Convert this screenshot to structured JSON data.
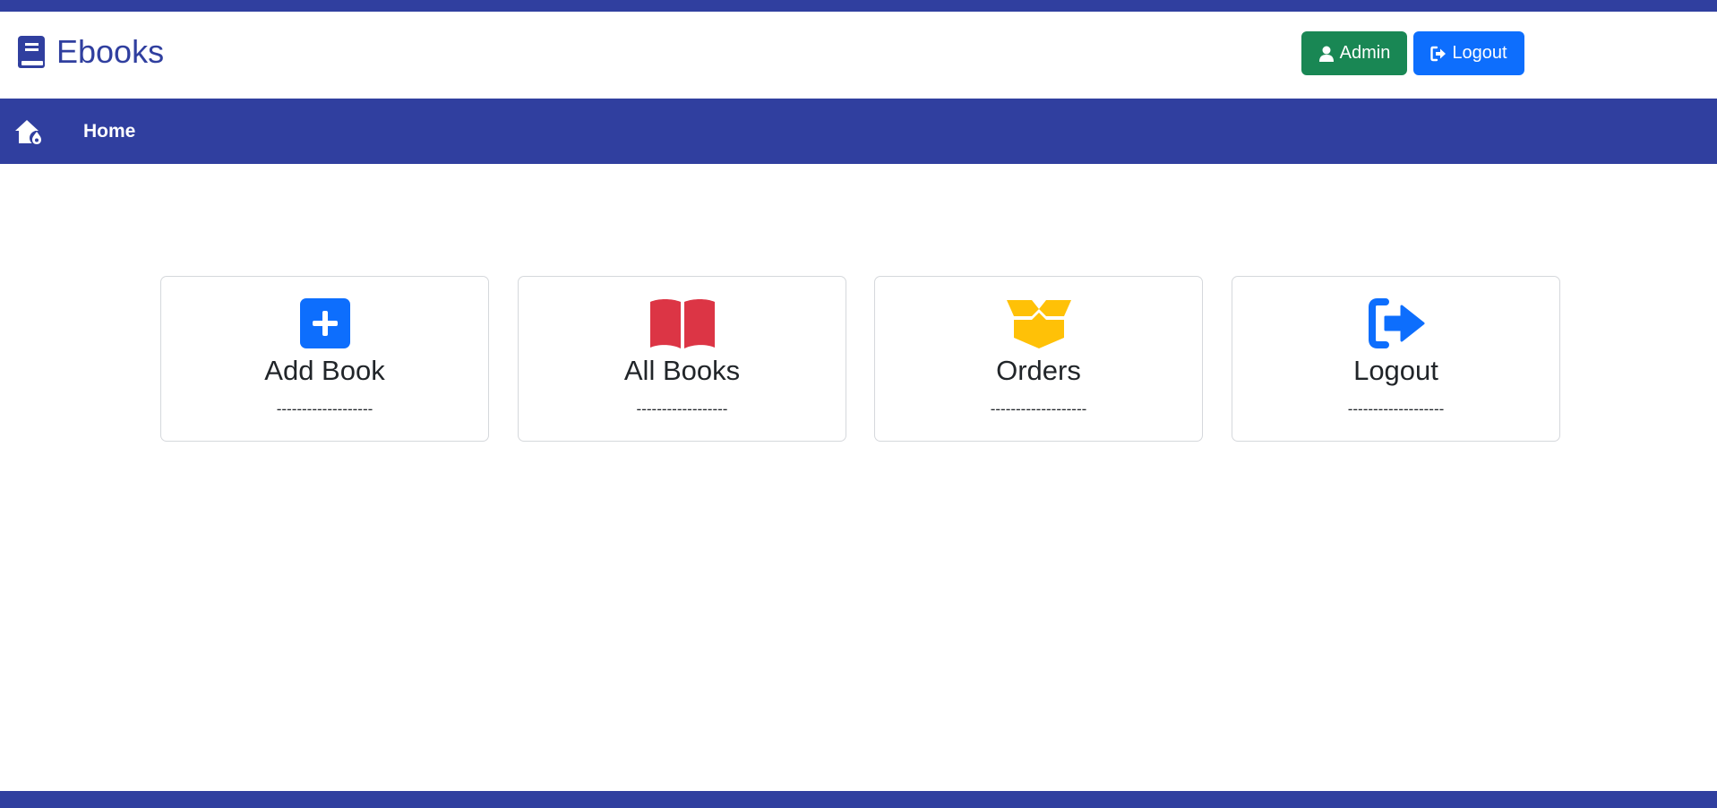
{
  "brand": {
    "name": "Ebooks",
    "icon": "book-icon",
    "color": "#303f9f"
  },
  "header_buttons": {
    "admin": {
      "label": "Admin",
      "icon": "user-icon",
      "color": "#198754"
    },
    "logout": {
      "label": "Logout",
      "icon": "sign-out-icon",
      "color": "#0d6efd"
    }
  },
  "navbar": {
    "home_icon": "home-icon",
    "home_label": "Home",
    "color": "#303f9f"
  },
  "cards": [
    {
      "title": "Add Book",
      "separator": "-------------------",
      "icon": "plus-square-icon",
      "icon_color": "#0d6efd"
    },
    {
      "title": "All Books",
      "separator": "------------------",
      "icon": "book-open-icon",
      "icon_color": "#dc3545"
    },
    {
      "title": "Orders",
      "separator": "-------------------",
      "icon": "box-open-icon",
      "icon_color": "#ffc107"
    },
    {
      "title": "Logout",
      "separator": "-------------------",
      "icon": "sign-out-icon",
      "icon_color": "#0d6efd"
    }
  ]
}
